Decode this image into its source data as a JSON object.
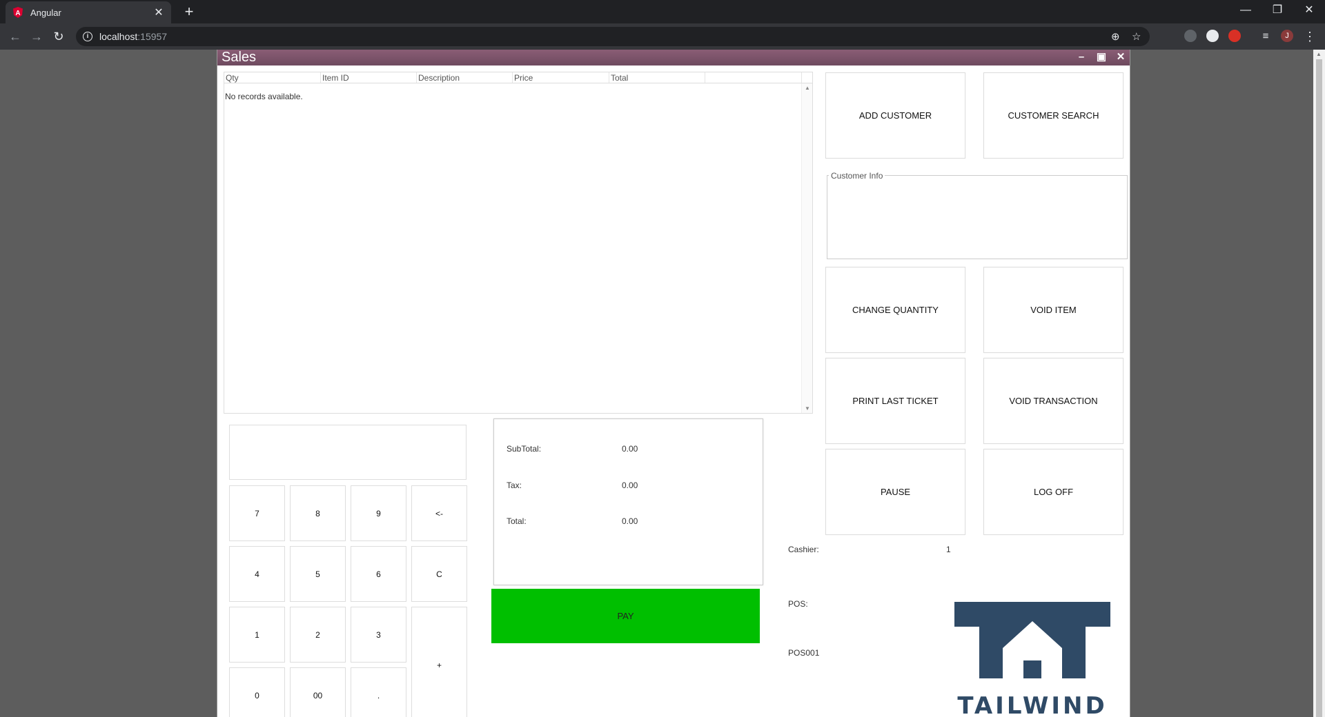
{
  "browser": {
    "tab_title": "Angular",
    "url_host": "localhost",
    "url_port": ":15957"
  },
  "window": {
    "title": "Sales"
  },
  "grid": {
    "columns": [
      "Qty",
      "Item ID",
      "Description",
      "Price",
      "Total"
    ],
    "empty_text": "No records available."
  },
  "keypad": {
    "keys": [
      "7",
      "8",
      "9",
      "<-",
      "4",
      "5",
      "6",
      "C",
      "1",
      "2",
      "3",
      "+",
      "0",
      "00",
      "."
    ]
  },
  "totals": {
    "subtotal_label": "SubTotal:",
    "subtotal_value": "0.00",
    "tax_label": "Tax:",
    "tax_value": "0.00",
    "total_label": "Total:",
    "total_value": "0.00"
  },
  "pay_label": "PAY",
  "actions": {
    "add_customer": "ADD CUSTOMER",
    "customer_search": "CUSTOMER SEARCH",
    "change_quantity": "CHANGE QUANTITY",
    "void_item": "VOID ITEM",
    "print_last_ticket": "PRINT LAST TICKET",
    "void_transaction": "VOID TRANSACTION",
    "pause": "PAUSE",
    "log_off": "LOG OFF"
  },
  "customer_info": {
    "legend": "Customer Info"
  },
  "status": {
    "cashier_label": "Cashier:",
    "cashier_value": "1",
    "pos_label": "POS:",
    "pos_value": "POS001"
  },
  "logo": {
    "text": "TAILWIND"
  },
  "colors": {
    "title_bar": "#7a5369",
    "pay_button": "#00bf00",
    "logo": "#2f4a66"
  }
}
